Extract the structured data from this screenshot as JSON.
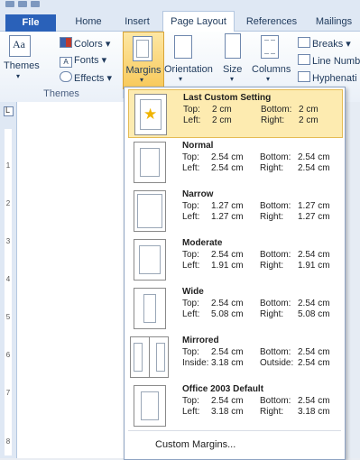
{
  "tabs": [
    "File",
    "Home",
    "Insert",
    "Page Layout",
    "References",
    "Mailings"
  ],
  "ribbon": {
    "themes": "Themes",
    "colors": "Colors",
    "fonts": "Fonts",
    "effects": "Effects",
    "themes_group": "Themes",
    "margins": "Margins",
    "orientation": "Orientation",
    "size": "Size",
    "columns": "Columns",
    "breaks": "Breaks",
    "line_numbers": "Line Numb",
    "hyphenation": "Hyphenati"
  },
  "ruler_numbers": [
    "1",
    "2",
    "3",
    "4",
    "5",
    "6",
    "7",
    "8"
  ],
  "menu": {
    "items": [
      {
        "title": "Last Custom Setting",
        "l1": "Top:",
        "v1": "2 cm",
        "l2": "Bottom:",
        "v2": "2 cm",
        "l3": "Left:",
        "v3": "2 cm",
        "l4": "Right:",
        "v4": "2 cm",
        "selected": true
      },
      {
        "title": "Normal",
        "l1": "Top:",
        "v1": "2.54 cm",
        "l2": "Bottom:",
        "v2": "2.54 cm",
        "l3": "Left:",
        "v3": "2.54 cm",
        "l4": "Right:",
        "v4": "2.54 cm"
      },
      {
        "title": "Narrow",
        "l1": "Top:",
        "v1": "1.27 cm",
        "l2": "Bottom:",
        "v2": "1.27 cm",
        "l3": "Left:",
        "v3": "1.27 cm",
        "l4": "Right:",
        "v4": "1.27 cm"
      },
      {
        "title": "Moderate",
        "l1": "Top:",
        "v1": "2.54 cm",
        "l2": "Bottom:",
        "v2": "2.54 cm",
        "l3": "Left:",
        "v3": "1.91 cm",
        "l4": "Right:",
        "v4": "1.91 cm"
      },
      {
        "title": "Wide",
        "l1": "Top:",
        "v1": "2.54 cm",
        "l2": "Bottom:",
        "v2": "2.54 cm",
        "l3": "Left:",
        "v3": "5.08 cm",
        "l4": "Right:",
        "v4": "5.08 cm"
      },
      {
        "title": "Mirrored",
        "l1": "Top:",
        "v1": "2.54 cm",
        "l2": "Bottom:",
        "v2": "2.54 cm",
        "l3": "Inside:",
        "v3": "3.18 cm",
        "l4": "Outside:",
        "v4": "2.54 cm"
      },
      {
        "title": "Office 2003 Default",
        "l1": "Top:",
        "v1": "2.54 cm",
        "l2": "Bottom:",
        "v2": "2.54 cm",
        "l3": "Left:",
        "v3": "3.18 cm",
        "l4": "Right:",
        "v4": "3.18 cm"
      }
    ],
    "custom_margins": "Custom Margins..."
  }
}
